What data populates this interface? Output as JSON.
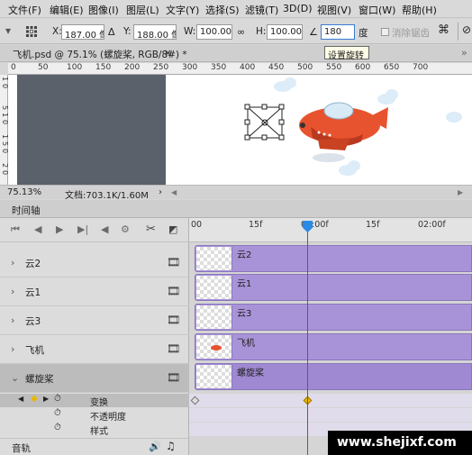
{
  "menu": [
    "文件(F)",
    "编辑(E)",
    "图像(I)",
    "图层(L)",
    "文字(Y)",
    "选择(S)",
    "滤镜(T)",
    "3D(D)",
    "视图(V)",
    "窗口(W)",
    "帮助(H)"
  ],
  "options": {
    "x_label": "X:",
    "x_value": "187.00 像素",
    "y_label": "Y:",
    "y_value": "188.00 像素",
    "w_label": "W:",
    "w_value": "100.00%",
    "h_label": "H:",
    "h_value": "100.00%",
    "angle_value": "180",
    "angle_unit": "度",
    "antialias_label": "消除锯齿",
    "tooltip": "设置旋转"
  },
  "document": {
    "tab": "飞机.psd @ 75.1% (螺旋桨, RGB/8#) *"
  },
  "rulers": {
    "h": [
      "0",
      "50",
      "100",
      "150",
      "200",
      "250",
      "300",
      "350",
      "400",
      "450",
      "500",
      "550",
      "600",
      "650",
      "700"
    ],
    "v": [
      "1",
      "0",
      "5",
      "1",
      "0",
      "1",
      "5",
      "0",
      "2",
      "0"
    ]
  },
  "status": {
    "zoom": "75.13%",
    "doc_info": "文档:703.1K/1.60M"
  },
  "timeline": {
    "title": "时间轴",
    "time_labels": [
      "00",
      "15f",
      "01:00f",
      "15f",
      "02:00f"
    ],
    "layers": [
      {
        "name": "云2",
        "clip_label": "云2"
      },
      {
        "name": "云1",
        "clip_label": "云1"
      },
      {
        "name": "云3",
        "clip_label": "云3"
      },
      {
        "name": "飞机",
        "clip_label": "飞机"
      },
      {
        "name": "螺旋桨",
        "clip_label": "螺旋桨"
      }
    ],
    "props": [
      "变换",
      "不透明度",
      "样式"
    ],
    "audio_label": "音轨"
  },
  "watermark": "www.shejixf.com",
  "colors": {
    "clip": "#a993d8",
    "playhead": "#2a8ae6",
    "playhead_line": "#d9263a",
    "keyframe": "#e8b800",
    "plane_body": "#e8532f",
    "canvas_dark": "#5a616b"
  },
  "icons": [
    "grid-icon",
    "delta-icon",
    "link-icon",
    "angle-icon",
    "warp-icon",
    "play-icon",
    "scissors-icon",
    "transition-icon",
    "film-icon",
    "stopwatch-icon",
    "speaker-icon",
    "music-note-icon"
  ]
}
